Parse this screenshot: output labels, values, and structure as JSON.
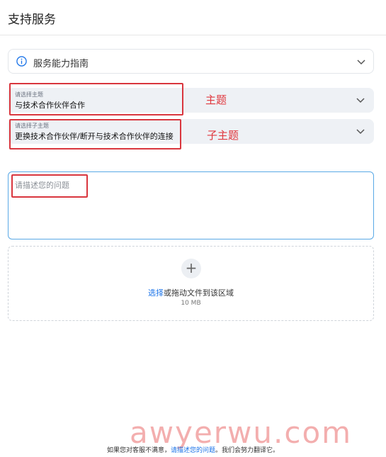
{
  "header": {
    "title": "支持服务"
  },
  "guide": {
    "label": "服务能力指南",
    "icon": "info-icon",
    "chevron": "chevron-down-icon"
  },
  "topic": {
    "small_label": "请选择主题",
    "value": "与技术合作伙伴合作",
    "annotation": "主题"
  },
  "subtopic": {
    "small_label": "请选择子主题",
    "value": "更换技术合作伙伴/断开与技术合作伙伴的连接",
    "annotation": "子主题"
  },
  "description": {
    "placeholder": "请描述您的问题"
  },
  "upload": {
    "link_text": "选择",
    "rest_text": "或拖动文件到该区域",
    "size_limit": "10 MB",
    "icon": "plus-icon"
  },
  "footer": {
    "prefix": "如果您对客服不满意，",
    "link": "请描述您的问题",
    "suffix": "。我们会努力翻译它。"
  },
  "watermark": "awyerwu.com",
  "colors": {
    "annotation_red": "#d9363e",
    "link_blue": "#1a73e8",
    "focus_border": "#5aa9e6"
  }
}
